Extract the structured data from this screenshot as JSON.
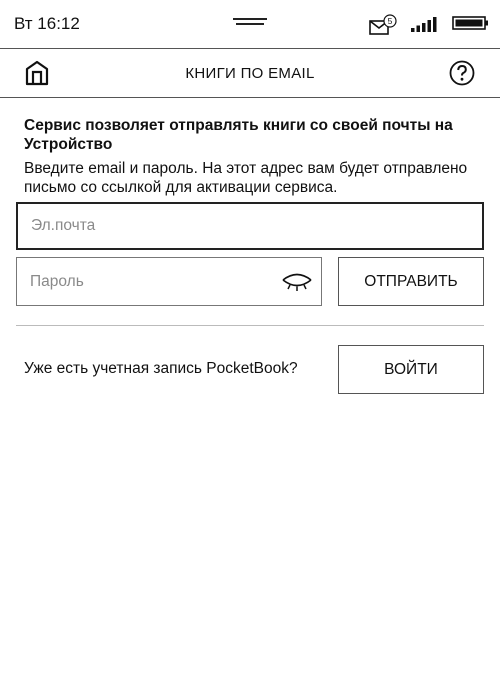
{
  "status_bar": {
    "time": "Вт 16:12",
    "notification_count": "5",
    "icons": [
      "menu-handle-icon",
      "mail-icon",
      "signal-icon",
      "battery-icon"
    ]
  },
  "header": {
    "title": "КНИГИ ПО EMAIL",
    "home_icon": "home-icon",
    "help_icon": "help-icon"
  },
  "intro": {
    "heading": "Сервис позволяет отправлять книги со своей почты на Устройство",
    "description": "Введите email и пароль. На этот адрес вам будет отправлено письмо со ссылкой для активации сервиса."
  },
  "form": {
    "email": {
      "value": "",
      "placeholder": "Эл.почта"
    },
    "password": {
      "value": "",
      "placeholder": "Пароль",
      "toggle_icon": "eye-closed-icon"
    },
    "send_label": "ОТПРАВИТЬ"
  },
  "account": {
    "question": "Уже есть учетная запись PocketBook?",
    "login_label": "ВОЙТИ"
  },
  "colors": {
    "border": "#555555",
    "text": "#111111",
    "placeholder": "#8a8a8a"
  }
}
